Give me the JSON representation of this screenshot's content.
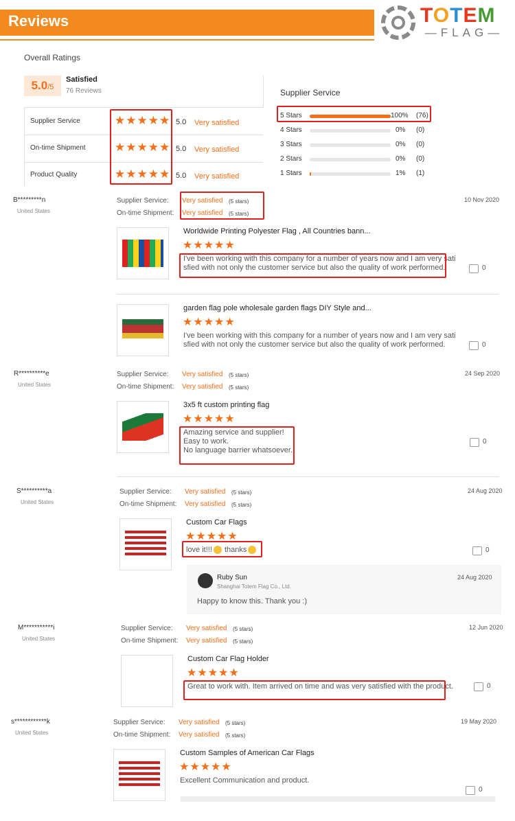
{
  "header": {
    "title": "Reviews",
    "logo_top": "TOTEM",
    "logo_bottom": "FLAG"
  },
  "overall": {
    "label": "Overall Ratings",
    "score": "5.0",
    "score_suffix": "/5",
    "status": "Satisfied",
    "review_count": "76 Reviews",
    "categories": [
      {
        "name": "Supplier Service",
        "value": "5.0",
        "text": "Very satisfied"
      },
      {
        "name": "On-time Shipment",
        "value": "5.0",
        "text": "Very satisfied"
      },
      {
        "name": "Product Quality",
        "value": "5.0",
        "text": "Very satisfied"
      }
    ]
  },
  "supplier_service": {
    "title": "Supplier Service",
    "rows": [
      {
        "label": "5 Stars",
        "percent": "100%",
        "count": "(76)",
        "fill": 1.0
      },
      {
        "label": "4 Stars",
        "percent": "0%",
        "count": "(0)",
        "fill": 0.0
      },
      {
        "label": "3 Stars",
        "percent": "0%",
        "count": "(0)",
        "fill": 0.0
      },
      {
        "label": "2 Stars",
        "percent": "0%",
        "count": "(0)",
        "fill": 0.0
      },
      {
        "label": "1 Stars",
        "percent": "1%",
        "count": "(1)",
        "fill": 0.01
      }
    ]
  },
  "labels": {
    "supplier_service": "Supplier Service:",
    "ontime": "On-time Shipment:",
    "five_stars": "(5 stars)"
  },
  "reviews": [
    {
      "user": "B*********n",
      "country": "United States",
      "date": "10 Nov 2020",
      "supplier": "Very satisfied",
      "ontime": "Very satisfied",
      "items": [
        {
          "title": "Worldwide Printing Polyester Flag , All Countries bann...",
          "text1": "I've been working with this company for a number of years now and I am very sati",
          "text2": "sfied with not only the customer service but also the quality of work performed.",
          "likes": "0"
        },
        {
          "title": "garden flag pole wholesale garden flags DIY Style and...",
          "text1": "I've been working with this company for a number of years now and I am very sati",
          "text2": "sfied with not only the customer service but also the quality of work performed.",
          "likes": "0"
        }
      ]
    },
    {
      "user": "R**********e",
      "country": "United States",
      "date": "24 Sep 2020",
      "supplier": "Very satisfied",
      "ontime": "Very satisfied",
      "items": [
        {
          "title": "3x5 ft custom printing flag",
          "text1": "Amazing service and supplier!",
          "text2": "Easy to work.",
          "text3": "No language barrier whatsoever.",
          "likes": "0"
        }
      ]
    },
    {
      "user": "S**********a",
      "country": "United States",
      "date": "24 Aug 2020",
      "supplier": "Very satisfied",
      "ontime": "Very satisfied",
      "items": [
        {
          "title": "Custom Car Flags",
          "text_a": "love it!!!",
          "text_b": "thanks",
          "likes": "0"
        }
      ],
      "reply": {
        "name": "Ruby Sun",
        "company": "Shanghai Totem Flag Co., Ltd.",
        "date": "24 Aug 2020",
        "text": "Happy to know this. Thank you :)"
      }
    },
    {
      "user": "M***********i",
      "country": "United States",
      "date": "12 Jun 2020",
      "supplier": "Very satisfied",
      "ontime": "Very satisfied",
      "items": [
        {
          "title": "Custom Car Flag Holder",
          "text1": "Great to work with. Item arrived on time and was very satisfied with the product.",
          "likes": "0"
        }
      ]
    },
    {
      "user": "s************k",
      "country": "United States",
      "date": "19 May 2020",
      "supplier": "Very satisfied",
      "ontime": "Very satisfied",
      "items": [
        {
          "title": "Custom Samples of American Car Flags",
          "text1": "Excellent Communication and product.",
          "likes": "0"
        }
      ]
    }
  ],
  "stars": "★★★★★",
  "colors": {
    "accent": "#f28a1d",
    "highlight": "#e01f1f",
    "star": "#f36f1a"
  }
}
